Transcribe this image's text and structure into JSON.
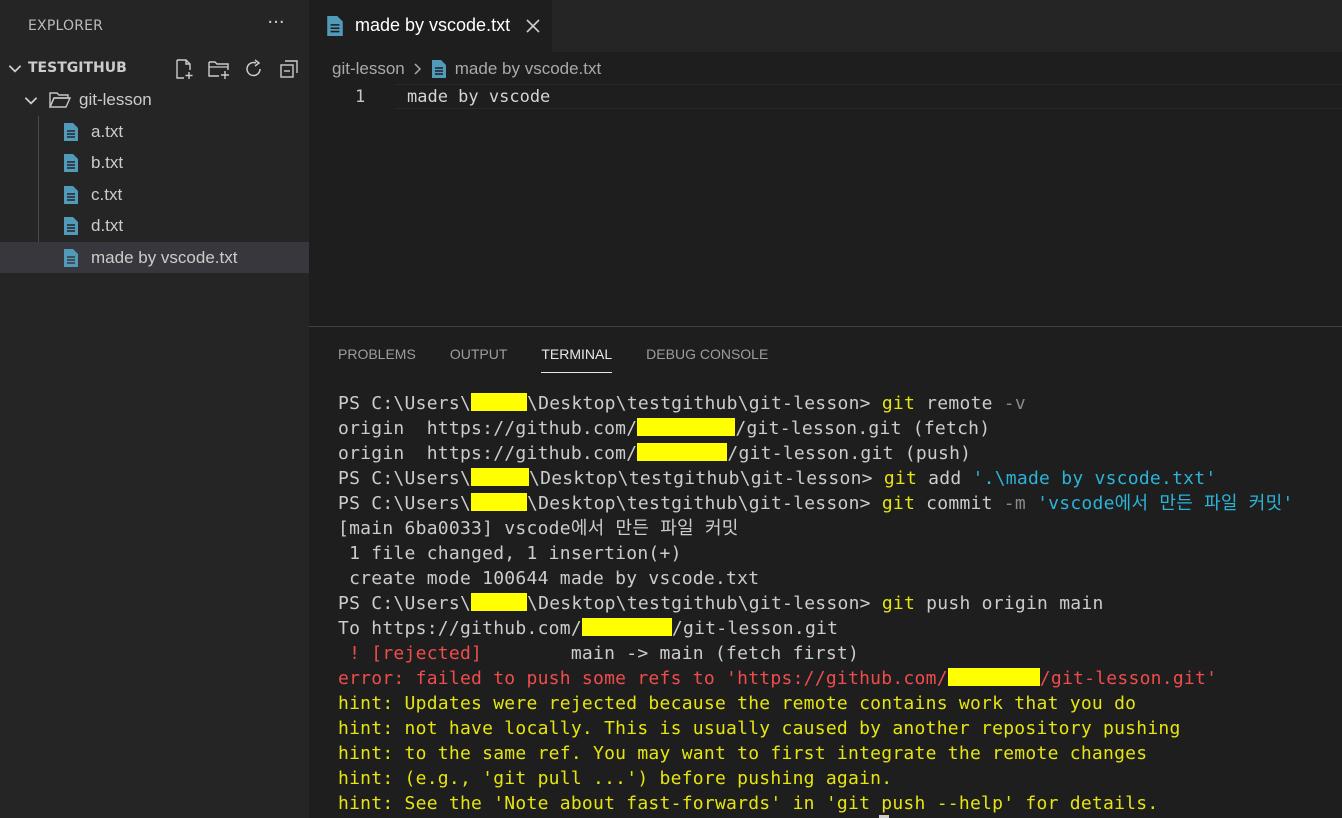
{
  "sidebar": {
    "title": "EXPLORER",
    "more": "···",
    "workspace": "TESTGITHUB",
    "folder": "git-lesson",
    "files": [
      "a.txt",
      "b.txt",
      "c.txt",
      "d.txt",
      "made by vscode.txt"
    ],
    "selected_file": "made by vscode.txt"
  },
  "editor": {
    "tab_label": "made by vscode.txt",
    "breadcrumb": [
      "git-lesson",
      "made by vscode.txt"
    ],
    "line_number": "1",
    "line_text": "made by vscode"
  },
  "panel": {
    "tabs": [
      "PROBLEMS",
      "OUTPUT",
      "TERMINAL",
      "DEBUG CONSOLE"
    ],
    "active_tab": "TERMINAL"
  },
  "terminal": {
    "l1_prompt": "PS C:\\Users\\",
    "l1_path": "\\Desktop\\testgithub\\git-lesson> ",
    "l1_cmd": "git",
    "l1_rest": " remote ",
    "l1_flag": "-v",
    "l2_a": "origin  https://github.com/",
    "l2_b": "/git-lesson.git (fetch)",
    "l3_a": "origin  https://github.com/",
    "l3_b": "/git-lesson.git (push)",
    "l4_prompt": "PS C:\\Users\\",
    "l4_path": "\\Desktop\\testgithub\\git-lesson> ",
    "l4_cmd": "git",
    "l4_rest": " add ",
    "l4_str": "'.\\made by vscode.txt'",
    "l5_prompt": "PS C:\\Users\\",
    "l5_path": "\\Desktop\\testgithub\\git-lesson> ",
    "l5_cmd": "git",
    "l5_rest": " commit ",
    "l5_flag": "-m",
    "l5_str": " 'vscode에서 만든 파일 커밋'",
    "l6": "[main 6ba0033] vscode에서 만든 파일 커밋",
    "l7": " 1 file changed, 1 insertion(+)",
    "l8": " create mode 100644 made by vscode.txt",
    "l9_prompt": "PS C:\\Users\\",
    "l9_path": "\\Desktop\\testgithub\\git-lesson> ",
    "l9_cmd": "git",
    "l9_rest": " push origin main",
    "l10_a": "To https://github.com/",
    "l10_b": "/git-lesson.git",
    "l11_red": " ! [rejected]",
    "l11_rest": "        main -> main (fetch first)",
    "l12_a": "error: failed to push some refs to 'https://github.com/",
    "l12_b": "/git-lesson.git'",
    "hint1": "hint: Updates were rejected because the remote contains work that you do",
    "hint2": "hint: not have locally. This is usually caused by another repository pushing",
    "hint3": "hint: to the same ref. You may want to first integrate the remote changes",
    "hint4": "hint: (e.g., 'git pull ...') before pushing again.",
    "hint5": "hint: See the 'Note about fast-forwards' in 'git push --help' for details."
  },
  "colors": {
    "file_icon": "#519aba",
    "redaction": "#ffff00",
    "hint": "#e5e510",
    "error": "#f14c4c",
    "string": "#2bb3d8"
  }
}
